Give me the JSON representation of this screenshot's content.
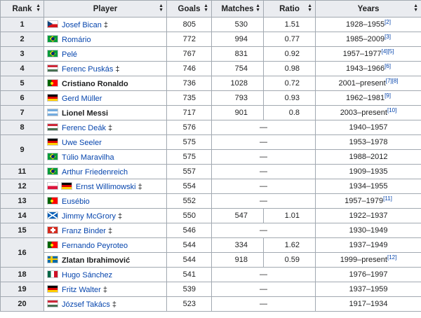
{
  "headers": {
    "rank": "Rank",
    "player": "Player",
    "goals": "Goals",
    "matches": "Matches",
    "ratio": "Ratio",
    "years": "Years"
  },
  "sort_icon": "sort-arrows-icon",
  "rows": [
    {
      "rank": "1",
      "flags": [
        "czech"
      ],
      "player": "Josef Bican",
      "dagger": "‡",
      "bold": false,
      "goals": "805",
      "matches": "530",
      "ratio": "1.51",
      "years": "1928–1955",
      "ref": "[2]"
    },
    {
      "rank": "2",
      "flags": [
        "brazil"
      ],
      "player": "Romário",
      "dagger": "",
      "bold": false,
      "goals": "772",
      "matches": "994",
      "ratio": "0.77",
      "years": "1985–2009",
      "ref": "[3]"
    },
    {
      "rank": "3",
      "flags": [
        "brazil"
      ],
      "player": "Pelé",
      "dagger": "",
      "bold": false,
      "goals": "767",
      "matches": "831",
      "ratio": "0.92",
      "years": "1957–1977",
      "ref": "[4][5]"
    },
    {
      "rank": "4",
      "flags": [
        "hungary"
      ],
      "player": "Ferenc Puskás",
      "dagger": "‡",
      "bold": false,
      "goals": "746",
      "matches": "754",
      "ratio": "0.98",
      "years": "1943–1966",
      "ref": "[6]"
    },
    {
      "rank": "5",
      "flags": [
        "portugal"
      ],
      "player": "Cristiano Ronaldo",
      "dagger": "",
      "bold": true,
      "goals": "736",
      "matches": "1028",
      "ratio": "0.72",
      "years": "2001–present",
      "ref": "[7][8]"
    },
    {
      "rank": "6",
      "flags": [
        "germany"
      ],
      "player": "Gerd Müller",
      "dagger": "",
      "bold": false,
      "goals": "735",
      "matches": "793",
      "ratio": "0.93",
      "years": "1962–1981",
      "ref": "[9]"
    },
    {
      "rank": "7",
      "flags": [
        "argentina"
      ],
      "player": "Lionel Messi",
      "dagger": "",
      "bold": true,
      "goals": "717",
      "matches": "901",
      "ratio": "0.8",
      "years": "2003–present",
      "ref": "[10]"
    },
    {
      "rank": "8",
      "flags": [
        "hungary"
      ],
      "player": "Ferenc Deák",
      "dagger": "‡",
      "bold": false,
      "goals": "576",
      "matches": "—",
      "ratio": "",
      "years": "1940–1957",
      "ref": ""
    },
    {
      "rank": "9",
      "flags": [
        "germany"
      ],
      "player": "Uwe Seeler",
      "dagger": "",
      "bold": false,
      "goals": "575",
      "matches": "—",
      "ratio": "",
      "years": "1953–1978",
      "ref": ""
    },
    {
      "rank": "",
      "flags": [
        "brazil"
      ],
      "player": "Túlio Maravilha",
      "dagger": "",
      "bold": false,
      "goals": "575",
      "matches": "—",
      "ratio": "",
      "years": "1988–2012",
      "ref": ""
    },
    {
      "rank": "11",
      "flags": [
        "brazil"
      ],
      "player": "Arthur Friedenreich",
      "dagger": "",
      "bold": false,
      "goals": "557",
      "matches": "—",
      "ratio": "",
      "years": "1909–1935",
      "ref": ""
    },
    {
      "rank": "12",
      "flags": [
        "poland",
        "germany"
      ],
      "player": "Ernst Willimowski",
      "dagger": "‡",
      "bold": false,
      "goals": "554",
      "matches": "—",
      "ratio": "",
      "years": "1934–1955",
      "ref": ""
    },
    {
      "rank": "13",
      "flags": [
        "portugal"
      ],
      "player": "Eusébio",
      "dagger": "",
      "bold": false,
      "goals": "552",
      "matches": "—",
      "ratio": "",
      "years": "1957–1979",
      "ref": "[11]"
    },
    {
      "rank": "14",
      "flags": [
        "scotland"
      ],
      "player": "Jimmy McGrory",
      "dagger": "‡",
      "bold": false,
      "goals": "550",
      "matches": "547",
      "ratio": "1.01",
      "years": "1922–1937",
      "ref": ""
    },
    {
      "rank": "15",
      "flags": [
        "switzerland"
      ],
      "player": "Franz Binder",
      "dagger": "‡",
      "bold": false,
      "goals": "546",
      "matches": "—",
      "ratio": "",
      "years": "1930–1949",
      "ref": ""
    },
    {
      "rank": "16",
      "flags": [
        "portugal"
      ],
      "player": "Fernando Peyroteo",
      "dagger": "",
      "bold": false,
      "goals": "544",
      "matches": "334",
      "ratio": "1.62",
      "years": "1937–1949",
      "ref": ""
    },
    {
      "rank": "",
      "flags": [
        "sweden"
      ],
      "player": "Zlatan Ibrahimović",
      "dagger": "",
      "bold": true,
      "goals": "544",
      "matches": "918",
      "ratio": "0.59",
      "years": "1999–present",
      "ref": "[12]"
    },
    {
      "rank": "18",
      "flags": [
        "mexico"
      ],
      "player": "Hugo Sánchez",
      "dagger": "",
      "bold": false,
      "goals": "541",
      "matches": "—",
      "ratio": "",
      "years": "1976–1997",
      "ref": ""
    },
    {
      "rank": "19",
      "flags": [
        "germany"
      ],
      "player": "Fritz Walter",
      "dagger": "‡",
      "bold": false,
      "goals": "539",
      "matches": "—",
      "ratio": "",
      "years": "1937–1959",
      "ref": ""
    },
    {
      "rank": "20",
      "flags": [
        "hungary"
      ],
      "player": "József Takács",
      "dagger": "‡",
      "bold": false,
      "goals": "523",
      "matches": "—",
      "ratio": "",
      "years": "1917–1934",
      "ref": ""
    }
  ]
}
